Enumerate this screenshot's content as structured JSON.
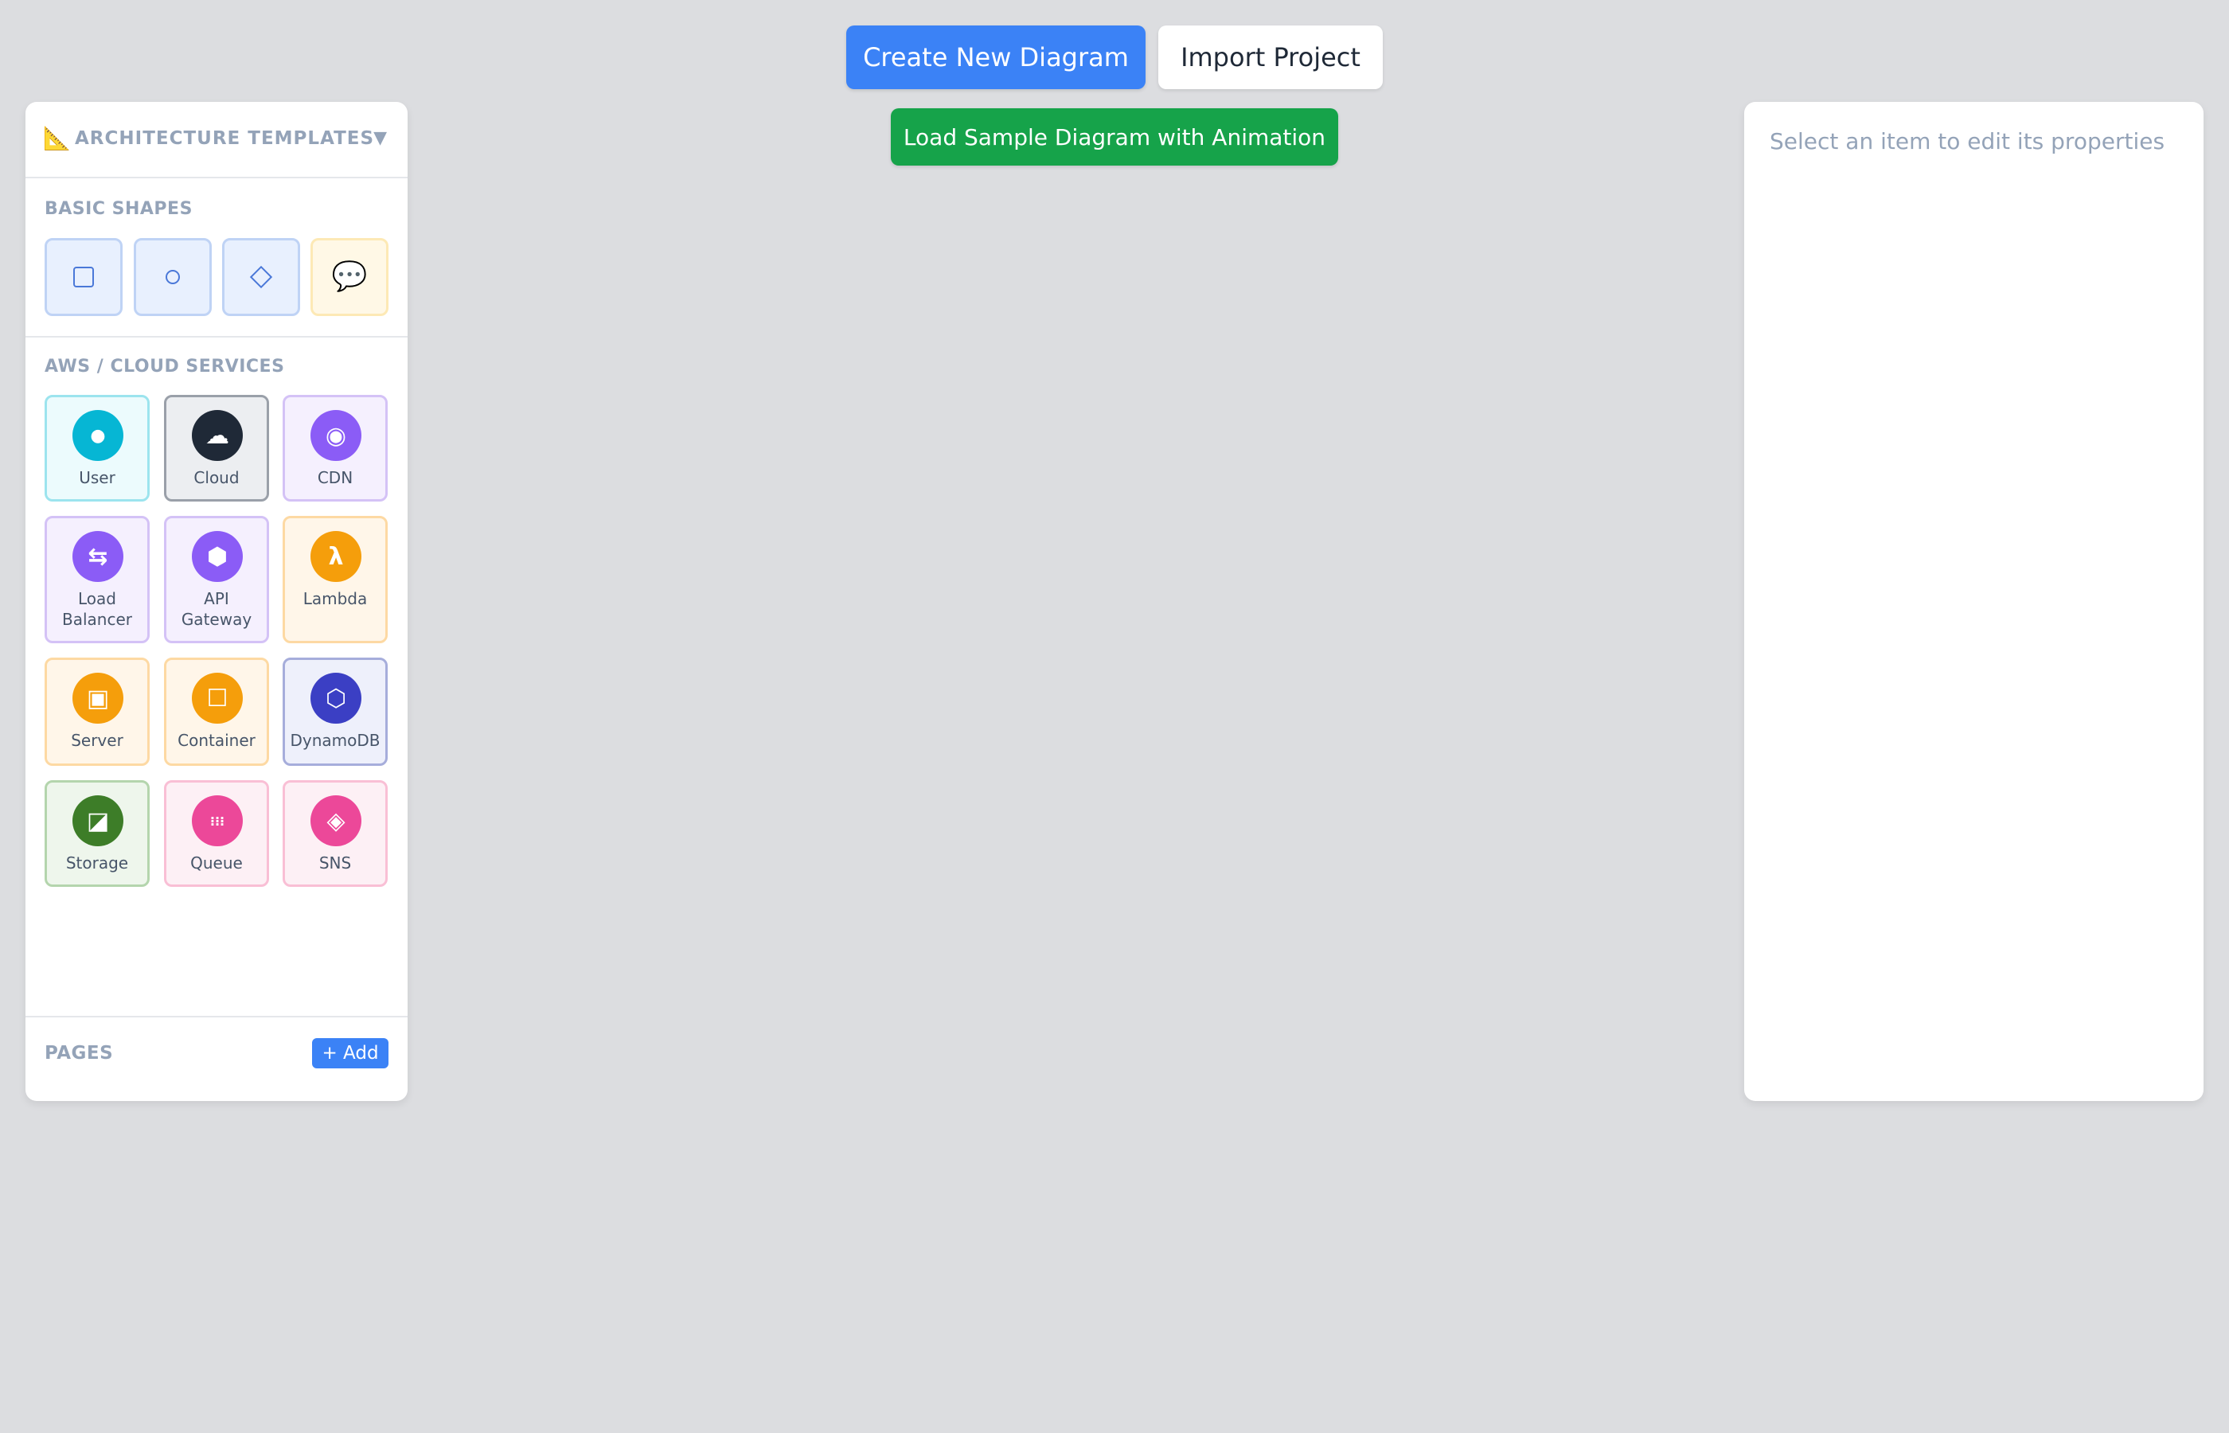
{
  "toolbar": {
    "create_label": "Create New Diagram",
    "import_label": "Import Project",
    "sample_label": "Load Sample Diagram with Animation"
  },
  "sidebar": {
    "header_icon": "📐",
    "title": "ARCHITECTURE TEMPLATES",
    "toggle": "▼",
    "basic_shapes_title": "BASIC SHAPES",
    "basic_shapes": [
      {
        "name": "rectangle-icon"
      },
      {
        "name": "circle-icon"
      },
      {
        "name": "diamond-icon"
      },
      {
        "name": "speech-bubble-icon",
        "glyph": "💬"
      }
    ],
    "cloud_title": "AWS / CLOUD SERVICES",
    "services": [
      {
        "label": "User",
        "glyph": "●",
        "icon": "user-icon",
        "color": "#06b6d4"
      },
      {
        "label": "Cloud",
        "glyph": "☁",
        "icon": "cloud-icon",
        "color": "#1f2937"
      },
      {
        "label": "CDN",
        "glyph": "◉",
        "icon": "cdn-icon",
        "color": "#8b5cf6"
      },
      {
        "label": "Load Balancer",
        "glyph": "⇆",
        "icon": "load-balancer-icon",
        "color": "#8b5cf6"
      },
      {
        "label": "API Gateway",
        "glyph": "⬢",
        "icon": "api-gateway-icon",
        "color": "#8b5cf6"
      },
      {
        "label": "Lambda",
        "glyph": "λ",
        "icon": "lambda-icon",
        "color": "#f59e0b"
      },
      {
        "label": "Server",
        "glyph": "▣",
        "icon": "server-icon",
        "color": "#f59e0b"
      },
      {
        "label": "Container",
        "glyph": "☐",
        "icon": "container-icon",
        "color": "#f59e0b"
      },
      {
        "label": "DynamoDB",
        "glyph": "⬡",
        "icon": "dynamodb-icon",
        "color": "#3b3fc4"
      },
      {
        "label": "Storage",
        "glyph": "◪",
        "icon": "storage-icon",
        "color": "#3d7d28"
      },
      {
        "label": "Queue",
        "glyph": "⁝⁝⁝",
        "icon": "queue-icon",
        "color": "#ec4899"
      },
      {
        "label": "SNS",
        "glyph": "◈",
        "icon": "sns-icon",
        "color": "#ec4899"
      }
    ],
    "pages_title": "PAGES",
    "add_label": "+ Add"
  },
  "properties": {
    "hint": "Select an item to edit its properties"
  }
}
